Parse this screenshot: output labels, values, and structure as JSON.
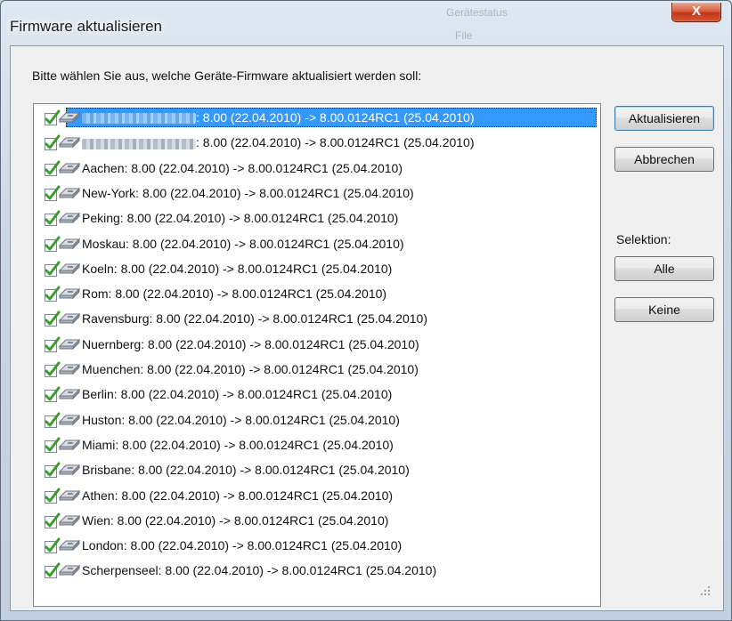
{
  "window": {
    "title": "Firmware aktualisieren",
    "close_label": "X",
    "background_ghost": [
      "Gerätestatus",
      "File"
    ]
  },
  "dialog": {
    "prompt": "Bitte wählen Sie aus, welche Geräte-Firmware aktualisiert werden soll:",
    "selection_label": "Selektion:"
  },
  "buttons": {
    "update": "Aktualisieren",
    "cancel": "Abbrechen",
    "all": "Alle",
    "none": "Keine"
  },
  "devices": [
    {
      "name": "",
      "redacted": true,
      "text": ": 8.00 (22.04.2010) -> 8.00.0124RC1 (25.04.2010)",
      "checked": true,
      "selected": true
    },
    {
      "name": "",
      "redacted": true,
      "text": ": 8.00 (22.04.2010) -> 8.00.0124RC1 (25.04.2010)",
      "checked": true,
      "selected": false
    },
    {
      "name": "Aachen",
      "text": "Aachen: 8.00 (22.04.2010) -> 8.00.0124RC1 (25.04.2010)",
      "checked": true
    },
    {
      "name": "New-York",
      "text": "New-York: 8.00 (22.04.2010) -> 8.00.0124RC1 (25.04.2010)",
      "checked": true
    },
    {
      "name": "Peking",
      "text": "Peking: 8.00 (22.04.2010) -> 8.00.0124RC1 (25.04.2010)",
      "checked": true
    },
    {
      "name": "Moskau",
      "text": "Moskau: 8.00 (22.04.2010) -> 8.00.0124RC1 (25.04.2010)",
      "checked": true
    },
    {
      "name": "Koeln",
      "text": "Koeln: 8.00 (22.04.2010) -> 8.00.0124RC1 (25.04.2010)",
      "checked": true
    },
    {
      "name": "Rom",
      "text": "Rom: 8.00 (22.04.2010) -> 8.00.0124RC1 (25.04.2010)",
      "checked": true
    },
    {
      "name": "Ravensburg",
      "text": "Ravensburg: 8.00 (22.04.2010) -> 8.00.0124RC1 (25.04.2010)",
      "checked": true
    },
    {
      "name": "Nuernberg",
      "text": "Nuernberg: 8.00 (22.04.2010) -> 8.00.0124RC1 (25.04.2010)",
      "checked": true
    },
    {
      "name": "Muenchen",
      "text": "Muenchen: 8.00 (22.04.2010) -> 8.00.0124RC1 (25.04.2010)",
      "checked": true
    },
    {
      "name": "Berlin",
      "text": "Berlin: 8.00 (22.04.2010) -> 8.00.0124RC1 (25.04.2010)",
      "checked": true
    },
    {
      "name": "Huston",
      "text": "Huston: 8.00 (22.04.2010) -> 8.00.0124RC1 (25.04.2010)",
      "checked": true
    },
    {
      "name": "Miami",
      "text": "Miami: 8.00 (22.04.2010) -> 8.00.0124RC1 (25.04.2010)",
      "checked": true
    },
    {
      "name": "Brisbane",
      "text": "Brisbane: 8.00 (22.04.2010) -> 8.00.0124RC1 (25.04.2010)",
      "checked": true
    },
    {
      "name": "Athen",
      "text": "Athen: 8.00 (22.04.2010) -> 8.00.0124RC1 (25.04.2010)",
      "checked": true
    },
    {
      "name": "Wien",
      "text": "Wien: 8.00 (22.04.2010) -> 8.00.0124RC1 (25.04.2010)",
      "checked": true
    },
    {
      "name": "London",
      "text": "London: 8.00 (22.04.2010) -> 8.00.0124RC1 (25.04.2010)",
      "checked": true
    },
    {
      "name": "Scherpenseel",
      "text": "Scherpenseel: 8.00 (22.04.2010) -> 8.00.0124RC1 (25.04.2010)",
      "checked": true
    }
  ],
  "icons": {
    "check": "green-check-icon",
    "device": "device-icon",
    "close": "close-icon",
    "resize": "resize-grip-icon"
  },
  "colors": {
    "selection": "#3399ff",
    "check_green": "#3a9d2a",
    "close_red": "#c23416"
  }
}
